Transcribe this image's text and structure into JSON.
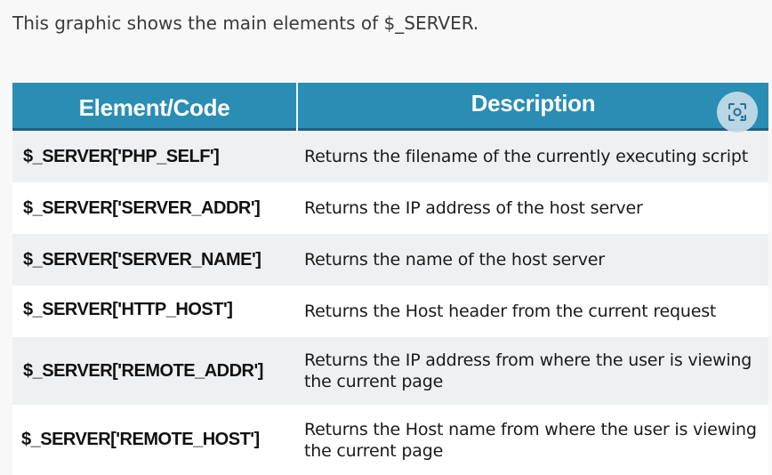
{
  "intro": "This graphic shows the main elements of $_SERVER.",
  "table": {
    "headers": [
      "Element/Code",
      "Description"
    ],
    "rows": [
      {
        "code": "$_SERVER['PHP_SELF']",
        "desc": "Returns the filename of the currently executing script"
      },
      {
        "code": "$_SERVER['SERVER_ADDR']",
        "desc": "Returns the IP address of the host server"
      },
      {
        "code": "$_SERVER['SERVER_NAME']",
        "desc": "Returns the name of the host server"
      },
      {
        "code": "$_SERVER['HTTP_HOST']",
        "desc": "Returns the Host header from the current request"
      },
      {
        "code": "$_SERVER['REMOTE_ADDR']",
        "desc": "Returns the IP address from where the user is viewing the current page"
      },
      {
        "code": "$_SERVER['REMOTE_HOST']",
        "desc": "Returns the Host name from where the user is viewing the current page"
      }
    ]
  },
  "overlay": {
    "icon": "lens-search-icon"
  },
  "colors": {
    "header_bg": "#2a8db3",
    "header_text": "#ffffff",
    "row_shade": "#eef0f2",
    "row_plain": "#ffffff"
  }
}
